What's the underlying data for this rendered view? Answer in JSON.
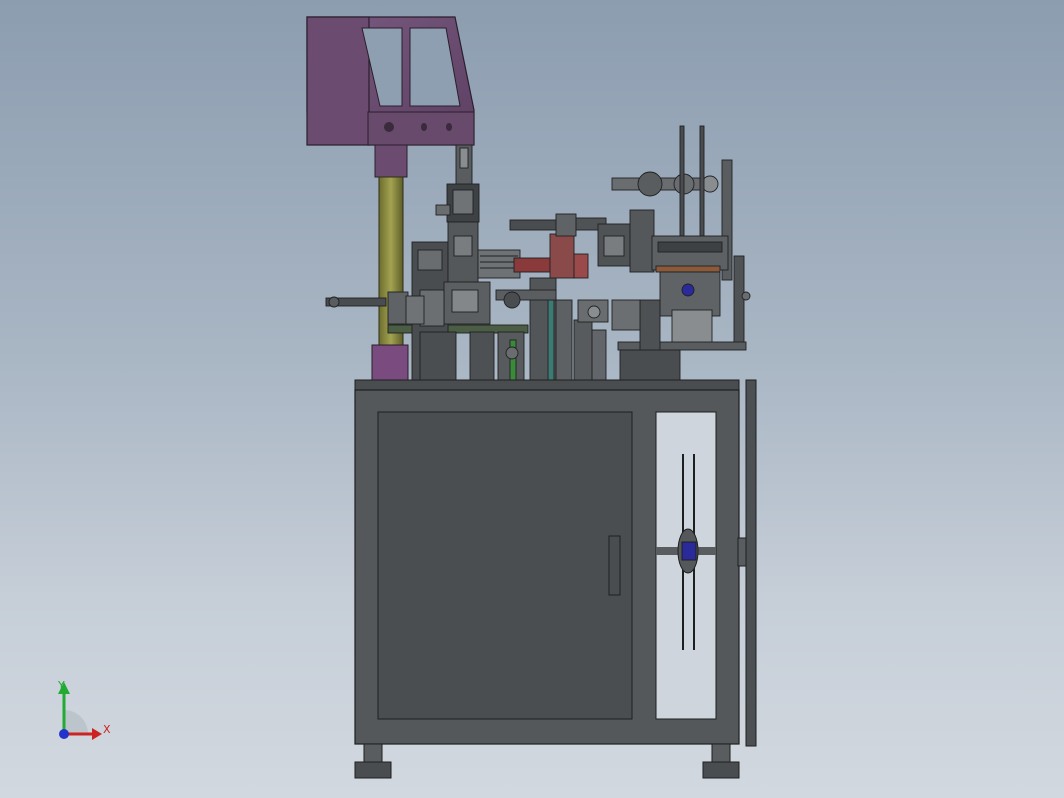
{
  "viewport": {
    "background_top": "#8c9db0",
    "background_bottom": "#d2d8df"
  },
  "model": {
    "cabinet_color": "#55585a",
    "frame_color": "#3d4042",
    "hood_color": "#6e4d72",
    "column_color": "#8a8a3e",
    "accent_red": "#8a3a3a",
    "accent_blue": "#2a2a9a",
    "accent_green": "#3a8a3a"
  },
  "triad": {
    "x_label": "X",
    "y_label": "Y",
    "x_color": "#cc2222",
    "y_color": "#22aa33",
    "z_color": "#2233cc",
    "x_icon": "arrow-right-icon",
    "y_icon": "arrow-up-icon"
  }
}
